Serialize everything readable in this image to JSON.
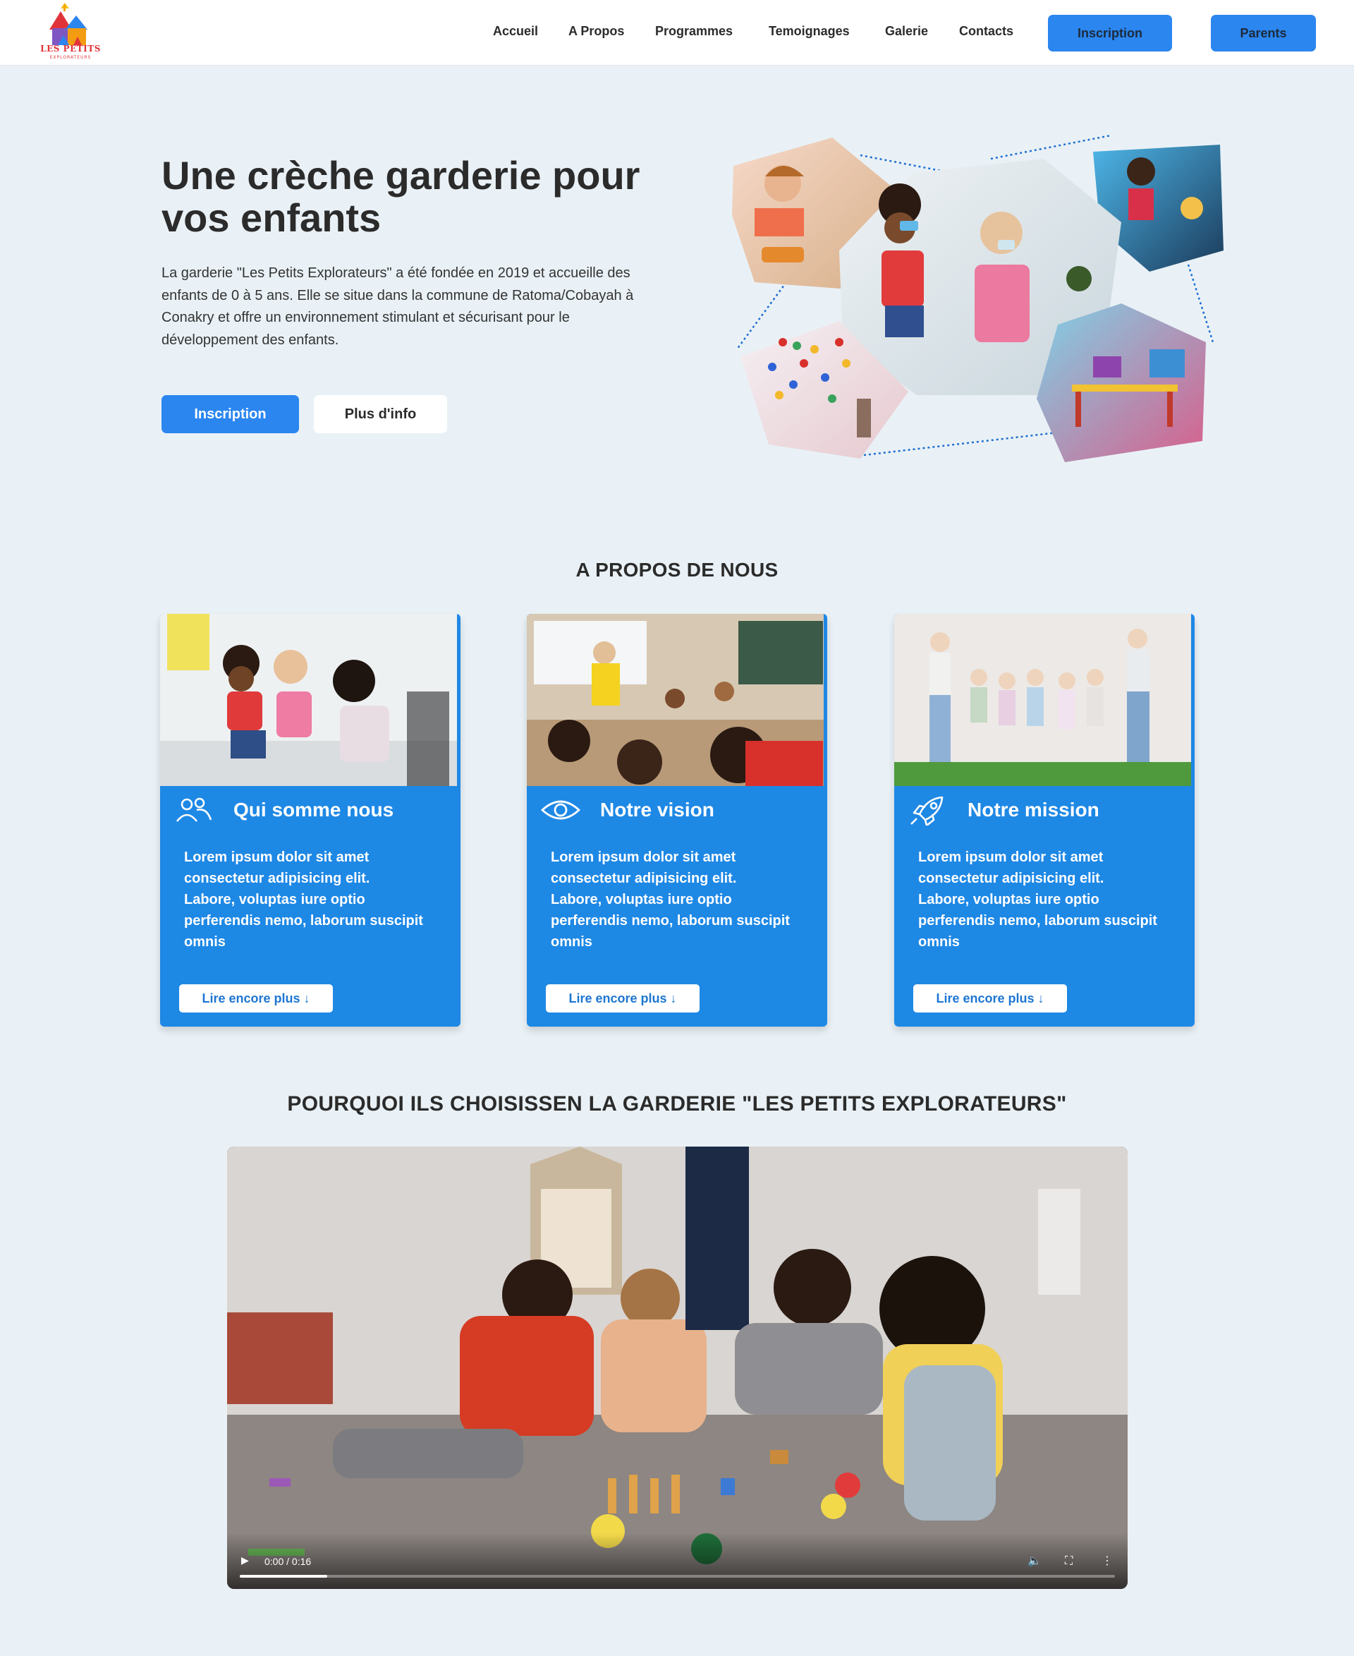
{
  "header": {
    "logo_text": "LES PETITS",
    "logo_subtext": "EXPLORATEURS",
    "nav": [
      "Accueil",
      "A Propos",
      "Programmes",
      "Temoignages",
      "Galerie",
      "Contacts"
    ],
    "inscription_button": "Inscription",
    "parents_button": "Parents"
  },
  "hero": {
    "title": "Une crèche garderie pour vos enfants",
    "text": "La garderie \"Les Petits Explorateurs\" a été fondée en 2019 et accueille des enfants de 0 à 5 ans. Elle se situe dans la commune de Ratoma/Cobayah à Conakry et offre un environnement stimulant et sécurisant pour le développement des enfants.",
    "primary_button": "Inscription",
    "secondary_button": "Plus d'info"
  },
  "about": {
    "title": "A PROPOS DE NOUS",
    "cards": [
      {
        "icon": "users-icon",
        "title": "Qui somme nous",
        "text": "Lorem ipsum dolor sit amet consectetur adipisicing elit. Labore, voluptas iure optio perferendis nemo, laborum suscipit omnis",
        "button": "Lire encore plus ↓"
      },
      {
        "icon": "eye-icon",
        "title": "Notre vision",
        "text": "Lorem ipsum dolor sit amet consectetur adipisicing elit. Labore, voluptas iure optio perferendis nemo, laborum suscipit omnis",
        "button": "Lire encore plus ↓"
      },
      {
        "icon": "rocket-icon",
        "title": "Notre mission",
        "text": "Lorem ipsum dolor sit amet consectetur adipisicing elit. Labore, voluptas iure optio perferendis nemo, laborum suscipit omnis",
        "button": "Lire encore plus ↓"
      }
    ]
  },
  "why": {
    "title": "POURQUOI ILS CHOISISSEN LA GARDERIE \"LES PETITS EXPLORATEURS\""
  },
  "video": {
    "time": "0:00 / 0:16",
    "progress": 0.1
  },
  "colors": {
    "accent": "#2b86f0",
    "card_blue": "#1e88e5",
    "page_bg": "#e9f1f6"
  }
}
